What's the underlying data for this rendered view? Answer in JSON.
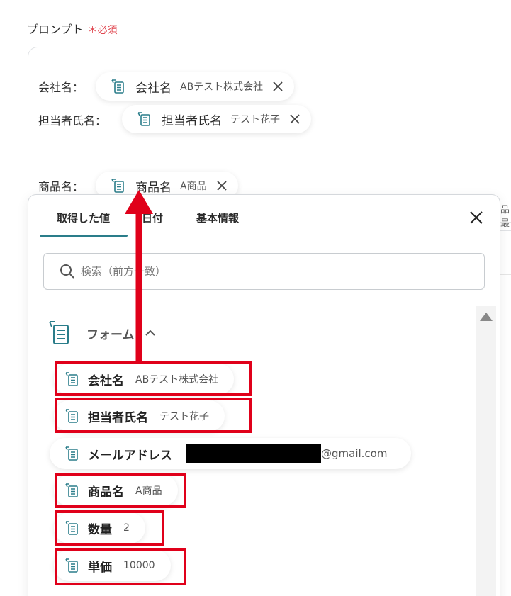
{
  "prompt": {
    "label": "プロンプト",
    "required_mark": "＊必須"
  },
  "prompt_fields": [
    {
      "label": "会社名：",
      "chip_name": "会社名",
      "chip_value": "ABテスト株式会社"
    },
    {
      "label": "担当者氏名：",
      "chip_name": "担当者氏名",
      "chip_value": "テスト花子"
    },
    {
      "label": "商品名：",
      "chip_name": "商品名",
      "chip_value": "A商品"
    }
  ],
  "right_strip_text": "品最",
  "dropdown": {
    "tabs": [
      "取得した値",
      "日付",
      "基本情報"
    ],
    "active_tab": "取得した値",
    "search_placeholder": "検索（前方一致）",
    "group": {
      "title": "フォーム",
      "expanded": true
    },
    "items": [
      {
        "name": "会社名",
        "value": "ABテスト株式会社",
        "highlighted": true
      },
      {
        "name": "担当者氏名",
        "value": "テスト花子",
        "highlighted": true
      },
      {
        "name": "メールアドレス",
        "value": "@gmail.com",
        "redacted_prefix": true,
        "highlighted": false
      },
      {
        "name": "商品名",
        "value": "A商品",
        "highlighted": true
      },
      {
        "name": "数量",
        "value": "2",
        "highlighted": true
      },
      {
        "name": "単価",
        "value": "10000",
        "highlighted": true
      }
    ]
  },
  "colors": {
    "accent": "#2a7d8a",
    "required": "#e0464f",
    "highlight": "#e0001a",
    "icon": "#2a7d8a"
  }
}
